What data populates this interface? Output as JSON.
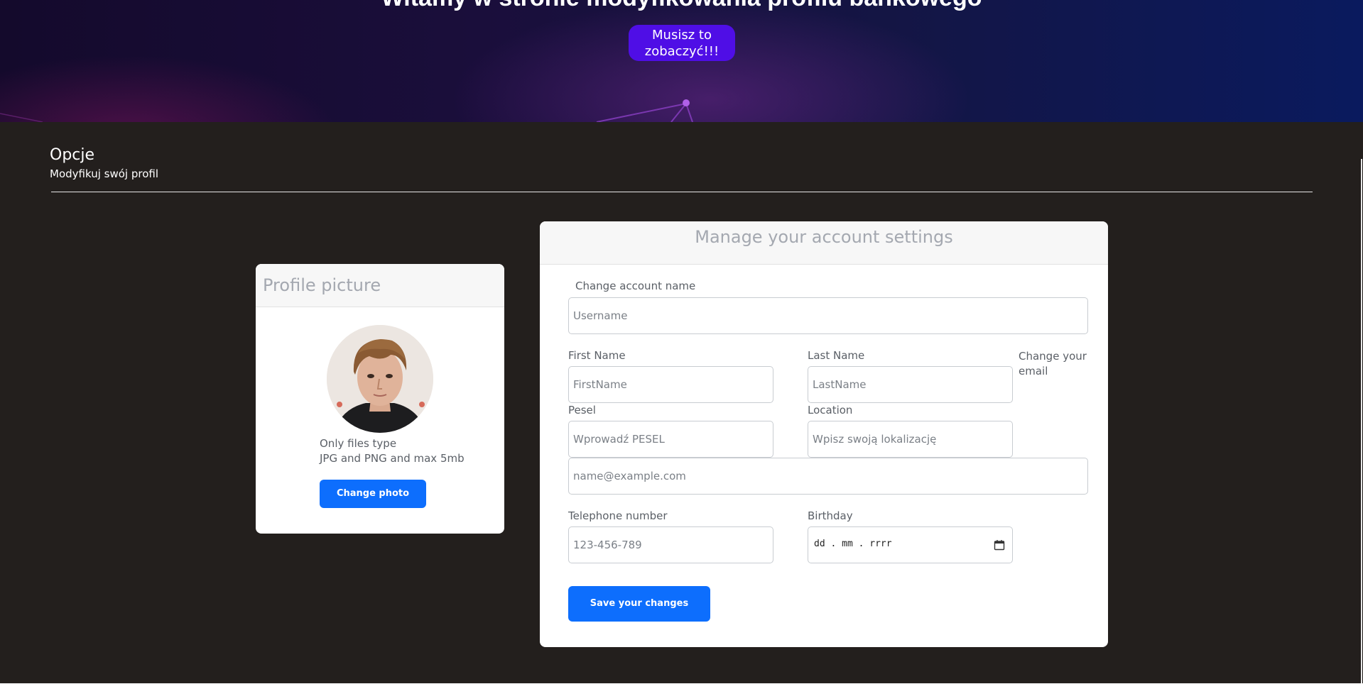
{
  "hero": {
    "title": "Witamy w stronie modyfikowania profilu bankowego",
    "button_line1": "Musisz to",
    "button_line2": "zobaczyć!!!"
  },
  "section": {
    "title": "Opcje",
    "subtitle": "Modyfikuj swój profil"
  },
  "profile_card": {
    "header": "Profile picture",
    "info_line1": "Only files type",
    "info_line2": "JPG and PNG and max 5mb",
    "change_photo_label": "Change photo"
  },
  "account_card": {
    "header": "Manage your account settings",
    "account_name_label": "Change account name",
    "username_placeholder": "Username",
    "first_name_label": "First Name",
    "first_name_placeholder": "FirstName",
    "last_name_label": "Last Name",
    "last_name_placeholder": "LastName",
    "email_label_line1": "Change your",
    "email_label_line2": "email",
    "pesel_label": "Pesel",
    "pesel_placeholder": "Wprowadź PESEL",
    "location_label": "Location",
    "location_placeholder": "Wpisz swoją lokalizację",
    "email_placeholder": "name@example.com",
    "telephone_label": "Telephone number",
    "telephone_placeholder": "123-456-789",
    "birthday_label": "Birthday",
    "birthday_placeholder": "dd . mm . rrrr",
    "save_label": "Save your changes"
  },
  "colors": {
    "accent_blue": "#0d6efd",
    "hero_button": "#4f0ee6",
    "main_background": "#231f1d"
  },
  "icons": [
    "calendar-icon"
  ]
}
